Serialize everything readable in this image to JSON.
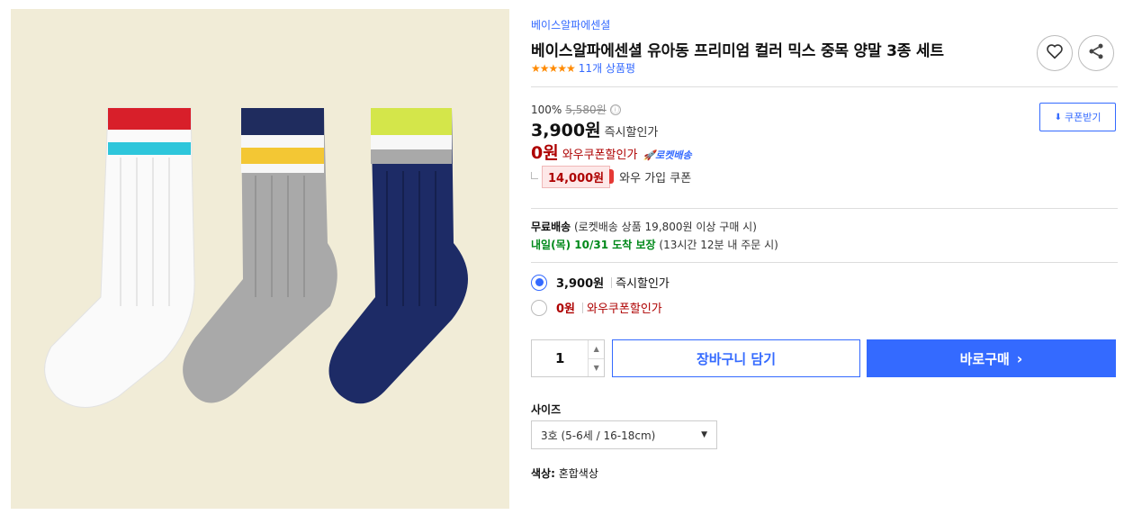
{
  "product": {
    "brand": "베이스알파에센셜",
    "title": "베이스알파에센셜 유아동 프리미엄 컬러 믹스 중목 양말 3종 세트",
    "stars": "★★★★★",
    "review_count": "11개 상품평"
  },
  "pricing": {
    "discount_rate": "100%",
    "original_price": "5,580원",
    "info_icon": "ⓘ",
    "instant_price": "3,900원",
    "instant_label": "즉시할인가",
    "wow_price": "0원",
    "wow_label": "와우쿠폰할인가",
    "rocket_label": "🚀로켓배송",
    "coupon_amount": "14,000원",
    "coupon_label": "와우 가입 쿠폰",
    "coupon_button": "쿠폰받기"
  },
  "shipping": {
    "free_label": "무료배송",
    "free_detail": "(로켓배송 상품 19,800원 이상 구매 시)",
    "delivery_date": "내일(목) 10/31 도착 보장",
    "delivery_detail": "(13시간 12분 내 주문 시)"
  },
  "options": [
    {
      "price": "3,900원",
      "label": "즉시할인가",
      "selected": true
    },
    {
      "price": "0원",
      "label": "와우쿠폰할인가",
      "selected": false
    }
  ],
  "quantity": {
    "value": "1"
  },
  "actions": {
    "cart_label": "장바구니 담기",
    "buy_label": "바로구매"
  },
  "size": {
    "label": "사이즈",
    "selected": "3호 (5-6세 / 16-18cm)"
  },
  "color": {
    "label": "색상:",
    "value": "혼합색상"
  },
  "icons": {
    "heart": "heart-icon",
    "share": "share-icon",
    "download": "download-icon"
  },
  "colors": {
    "accent": "#346aff",
    "wow_red": "#ae0000",
    "delivery_green": "#00891a",
    "star_orange": "#ff8a00"
  }
}
